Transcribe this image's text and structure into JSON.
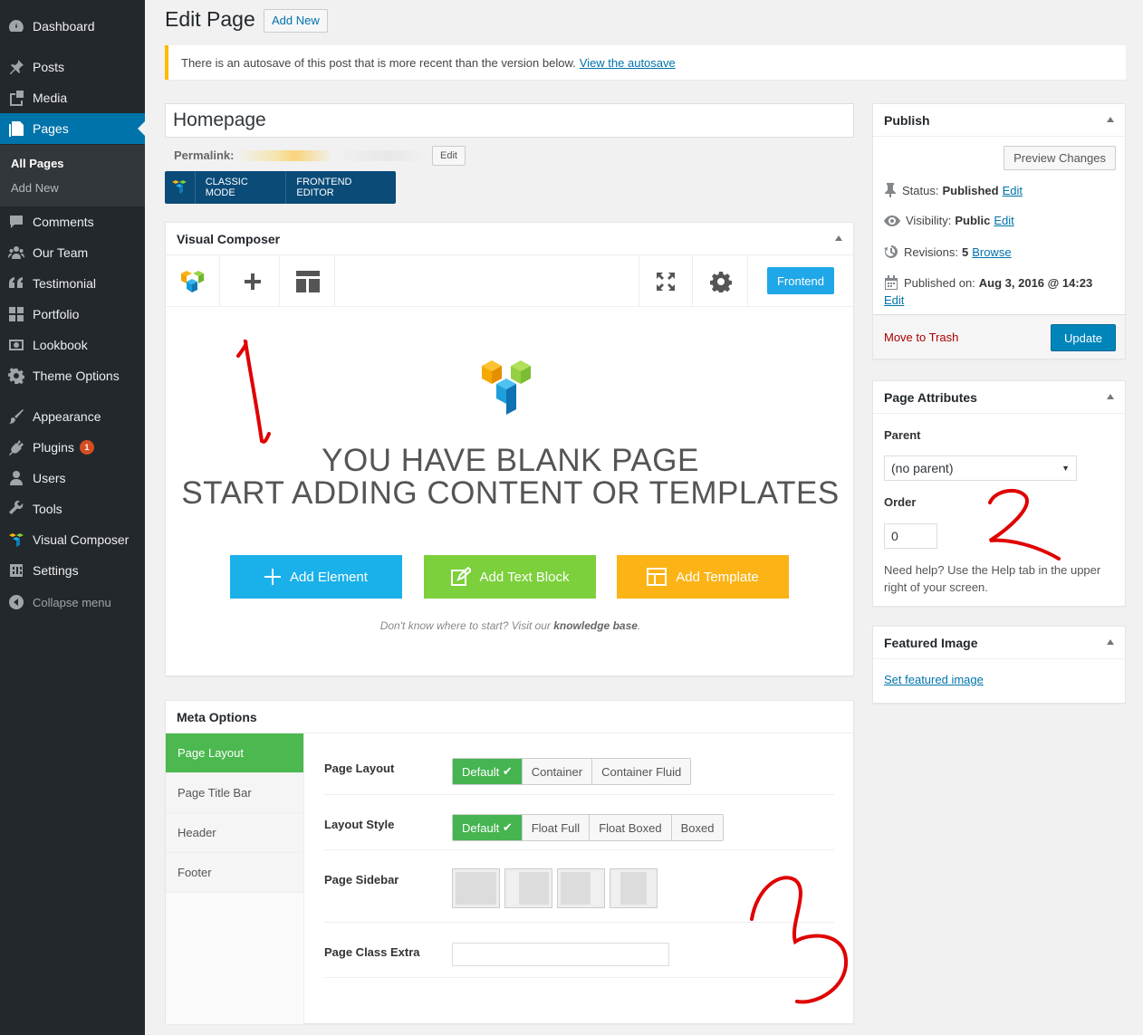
{
  "sidebar": {
    "items": [
      {
        "label": "Dashboard",
        "icon": "dashboard-icon"
      },
      {
        "label": "Posts",
        "icon": "pin-icon"
      },
      {
        "label": "Media",
        "icon": "media-icon"
      },
      {
        "label": "Pages",
        "icon": "pages-icon"
      },
      {
        "label": "Comments",
        "icon": "comments-icon"
      },
      {
        "label": "Our Team",
        "icon": "team-icon"
      },
      {
        "label": "Testimonial",
        "icon": "quote-icon"
      },
      {
        "label": "Portfolio",
        "icon": "grid-icon"
      },
      {
        "label": "Lookbook",
        "icon": "lookbook-icon"
      },
      {
        "label": "Theme Options",
        "icon": "gear-icon"
      },
      {
        "label": "Appearance",
        "icon": "brush-icon"
      },
      {
        "label": "Plugins",
        "icon": "plug-icon",
        "badge": "1"
      },
      {
        "label": "Users",
        "icon": "user-icon"
      },
      {
        "label": "Tools",
        "icon": "wrench-icon"
      },
      {
        "label": "Visual Composer",
        "icon": "vc-logo-icon"
      },
      {
        "label": "Settings",
        "icon": "settings-icon"
      }
    ],
    "submenu": [
      "All Pages",
      "Add New"
    ],
    "collapse": "Collapse menu"
  },
  "header": {
    "title": "Edit Page",
    "add_new": "Add New"
  },
  "notice": {
    "text": "There is an autosave of this post that is more recent than the version below.",
    "link": "View the autosave"
  },
  "post": {
    "title": "Homepage",
    "permalink_label": "Permalink:",
    "permalink_edit": "Edit",
    "mode_classic": "CLASSIC MODE",
    "mode_frontend": "FRONTEND EDITOR"
  },
  "vc": {
    "title": "Visual Composer",
    "frontend": "Frontend",
    "headline_1": "YOU HAVE BLANK PAGE",
    "headline_2": "START ADDING CONTENT OR TEMPLATES",
    "add_element": "Add Element",
    "add_text_block": "Add Text Block",
    "add_template": "Add Template",
    "help_text": "Don't know where to start? Visit our",
    "help_link": "knowledge base",
    "colors": {
      "element": "#1ab0ea",
      "text_block": "#7cd03b",
      "template": "#fcb316"
    }
  },
  "meta": {
    "title": "Meta Options",
    "tabs": [
      "Page Layout",
      "Page Title Bar",
      "Header",
      "Footer"
    ],
    "page_layout": {
      "label": "Page Layout",
      "options": [
        "Default",
        "Container",
        "Container Fluid"
      ]
    },
    "layout_style": {
      "label": "Layout Style",
      "options": [
        "Default",
        "Float Full",
        "Float Boxed",
        "Boxed"
      ]
    },
    "page_sidebar": {
      "label": "Page Sidebar"
    },
    "page_class": {
      "label": "Page Class Extra",
      "value": ""
    }
  },
  "publish": {
    "title": "Publish",
    "preview": "Preview Changes",
    "status_label": "Status:",
    "status_value": "Published",
    "visibility_label": "Visibility:",
    "visibility_value": "Public",
    "revisions_label": "Revisions:",
    "revisions_value": "5",
    "revisions_link": "Browse",
    "published_label": "Published on:",
    "published_value": "Aug 3, 2016 @ 14:23",
    "edit": "Edit",
    "trash": "Move to Trash",
    "update": "Update"
  },
  "attributes": {
    "title": "Page Attributes",
    "parent_label": "Parent",
    "parent_value": "(no parent)",
    "order_label": "Order",
    "order_value": "0",
    "help": "Need help? Use the Help tab in the upper right of your screen."
  },
  "featured": {
    "title": "Featured Image",
    "link": "Set featured image"
  }
}
